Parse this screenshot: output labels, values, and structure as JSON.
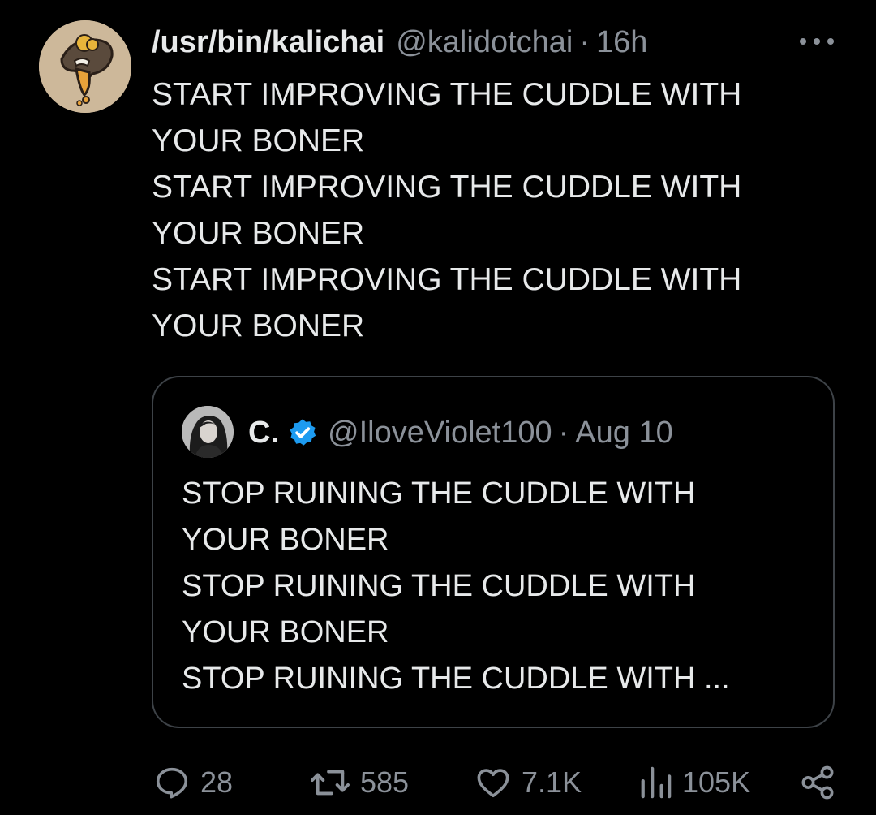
{
  "tweet": {
    "author": {
      "display_name": "/usr/bin/kalichai",
      "handle": "@kalidotchai",
      "avatar_icon": "cartoon-avatar"
    },
    "separator": "·",
    "time": "16h",
    "more_icon": "more-horizontal-icon",
    "text_lines": [
      "START IMPROVING THE CUDDLE WITH",
      "YOUR BONER",
      "START IMPROVING THE CUDDLE WITH",
      "YOUR BONER",
      "START IMPROVING THE CUDDLE WITH",
      "YOUR BONER"
    ]
  },
  "quoted_tweet": {
    "author": {
      "display_name": "C.",
      "verified": true,
      "verified_color": "#1d9bf0",
      "handle": "@IloveViolet100",
      "avatar_icon": "profile-photo"
    },
    "separator": "·",
    "date": "Aug 10",
    "text_lines": [
      "STOP RUINING THE CUDDLE WITH",
      "YOUR BONER",
      "STOP RUINING THE CUDDLE WITH",
      "YOUR BONER",
      "STOP RUINING THE CUDDLE WITH ..."
    ]
  },
  "actions": {
    "replies": "28",
    "retweets": "585",
    "likes": "7.1K",
    "views": "105K",
    "icons": [
      "reply-icon",
      "retweet-icon",
      "like-icon",
      "views-icon",
      "share-icon"
    ]
  },
  "colors": {
    "background": "#000000",
    "primary_text": "#e7e9ea",
    "secondary_text": "#8b9199",
    "border": "#3d4247"
  }
}
